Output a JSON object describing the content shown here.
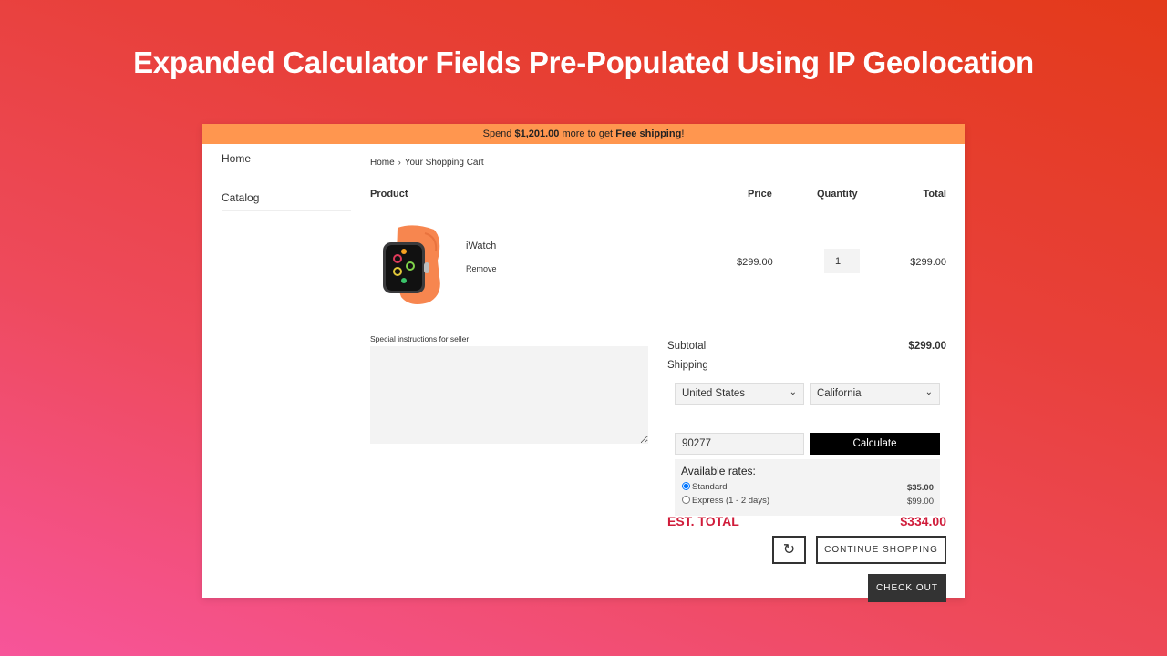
{
  "headline": "Expanded Calculator Fields Pre-Populated Using IP Geolocation",
  "promo": {
    "prefix": "Spend ",
    "amount": "$1,201.00",
    "middle": " more to get ",
    "bold_goal": "Free shipping",
    "suffix": "!"
  },
  "nav": {
    "items": [
      {
        "label": "Home"
      },
      {
        "label": "Catalog"
      }
    ]
  },
  "breadcrumb": {
    "items": [
      "Home",
      "Your Shopping Cart"
    ],
    "separator": "›"
  },
  "table": {
    "headers": {
      "product": "Product",
      "price": "Price",
      "quantity": "Quantity",
      "total": "Total"
    },
    "rows": [
      {
        "name": "iWatch",
        "remove_label": "Remove",
        "price": "$299.00",
        "quantity": "1",
        "total": "$299.00",
        "image": "watch-orange-band"
      }
    ]
  },
  "notes": {
    "label": "Special instructions for seller",
    "value": ""
  },
  "summary": {
    "subtotal_label": "Subtotal",
    "subtotal_value": "$299.00",
    "shipping_label": "Shipping",
    "country": "United States",
    "province": "California",
    "zip": "90277",
    "calculate_label": "Calculate",
    "rates_title": "Available rates:",
    "rates": [
      {
        "label": "Standard",
        "price": "$35.00",
        "selected": true
      },
      {
        "label": "Express (1 - 2 days)",
        "price": "$99.00",
        "selected": false
      }
    ],
    "est_total_label": "EST. TOTAL",
    "est_total_value": "$334.00"
  },
  "actions": {
    "refresh_icon": "refresh-icon",
    "continue_label": "CONTINUE SHOPPING",
    "checkout_label": "CHECK OUT"
  },
  "colors": {
    "promo_bar": "#ff964f",
    "est_total": "#d01c3a",
    "checkout_bg": "#333333",
    "calculate_bg": "#000000"
  }
}
